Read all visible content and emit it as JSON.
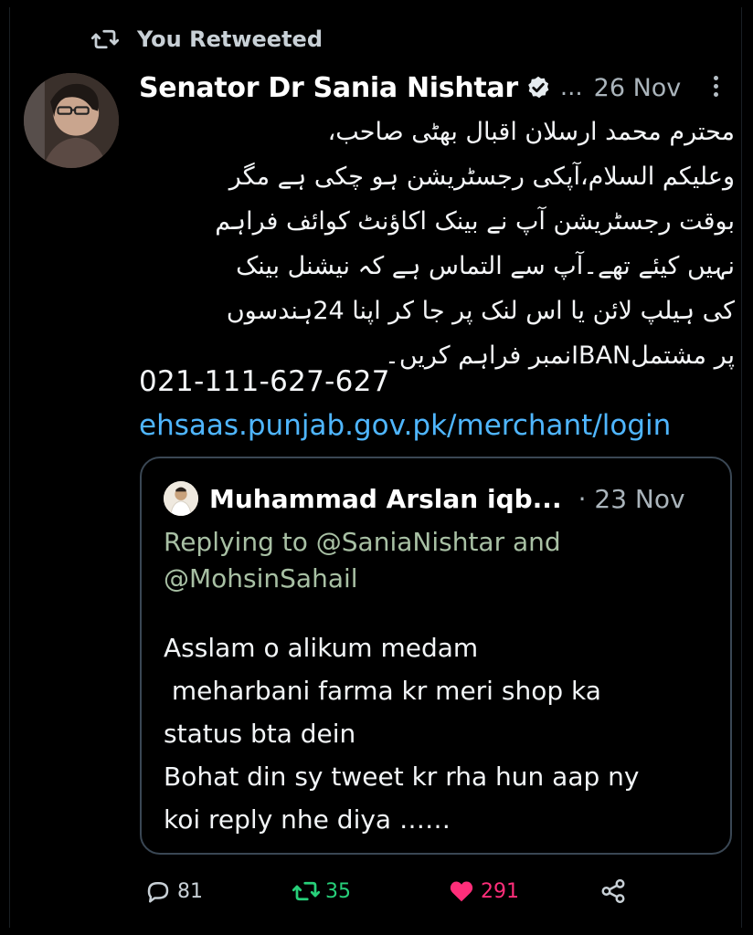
{
  "retweet_banner": {
    "icon": "retweet-icon",
    "text": "You Retweeted"
  },
  "tweet": {
    "author_name": "Senator Dr Sania Nishtar",
    "verified": true,
    "truncation": "...",
    "dot": "·",
    "date": "26 Nov",
    "body_urdu_lines": [
      "محترم محمد ارسلان اقبال بھٹی صاحب،",
      "وعلیکم السلام،آپکی رجسٹریشن ہو چکی ہے مگر",
      "بوقت رجسٹریشن آپ نے بینک اکاؤنٹ کوائف فراہم",
      "نہیں کیئے تھے۔آپ سے التماس ہے کہ نیشنل بینک",
      "کی ہیلپ لائن یا اس لنک پر جا کر اپنا 24ہندسوں",
      "پر مشتملIBANنمبر فراہم کریں۔"
    ],
    "phone": "021-111-627-627",
    "link": "ehsaas.punjab.gov.pk/merchant/login"
  },
  "quoted_tweet": {
    "author_name": "Muhammad Arslan iqb...",
    "date": "· 23 Nov",
    "replying_prefix": "Replying to ",
    "reply_handle_1": "@SaniaNishtar",
    "reply_and": " and",
    "reply_handle_2": "@MohsinSahail",
    "body_lines": [
      "Asslam o alikum medam",
      " meharbani farma kr meri shop ka",
      "status bta dein",
      "Bohat din sy tweet kr rha hun aap ny",
      "koi reply nhe diya ……"
    ]
  },
  "actions": {
    "replies": "81",
    "retweets": "35",
    "likes": "291"
  },
  "colors": {
    "background": "#000000",
    "link": "#4fb6ff",
    "retweet_green": "#27d07a",
    "like_pink": "#ff2e7a",
    "verified_blue": "#e6ecf0",
    "card_border": "#3a4754"
  }
}
